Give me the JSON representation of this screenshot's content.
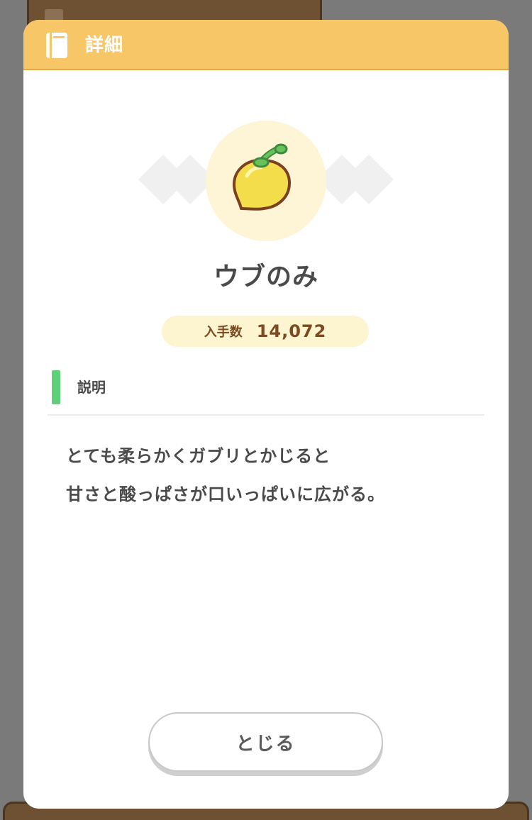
{
  "modal": {
    "header_title": "詳細",
    "header_icon": "notebook-icon",
    "item": {
      "name": "ウブのみ",
      "icon": "yellow-berry-icon",
      "count_label": "入手数",
      "count_value": "14,072"
    },
    "section": {
      "title": "説明",
      "accent_color": "#5ed07a"
    },
    "description_lines": [
      "とても柔らかくガブリとかじると",
      "甘さと酸っぱさが口いっぱいに広がる。"
    ],
    "close_label": "とじる"
  },
  "colors": {
    "header_bg": "#f6c667",
    "count_pill_bg": "#fdf5d0",
    "item_circle_bg": "#fdf5d5",
    "overlay": "#7a7a7a"
  }
}
